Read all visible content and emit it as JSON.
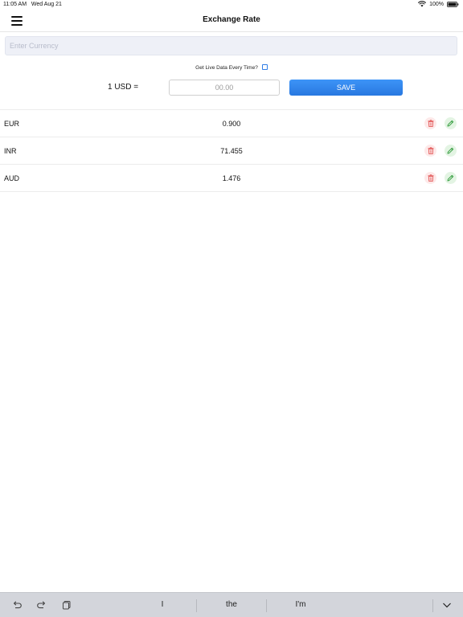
{
  "status_bar": {
    "time": "11:05 AM",
    "date": "Wed Aug 21",
    "battery": "100%",
    "icons": [
      "wifi-icon",
      "battery-icon"
    ]
  },
  "nav": {
    "title": "Exchange Rate",
    "menu_icon": "hamburger-menu-icon"
  },
  "search": {
    "placeholder": "Enter Currency",
    "value": ""
  },
  "live_data": {
    "label": "Get Live Data Every Time?",
    "checked": false
  },
  "rate_form": {
    "label": "1 USD =",
    "placeholder": "00.00",
    "save_label": "SAVE"
  },
  "rates": [
    {
      "code": "EUR",
      "value": "0.900"
    },
    {
      "code": "INR",
      "value": "71.455"
    },
    {
      "code": "AUD",
      "value": "1.476"
    }
  ],
  "keyboard": {
    "suggestions": [
      "I",
      "the",
      "I'm"
    ],
    "icons": [
      "undo-icon",
      "redo-icon",
      "paste-icon",
      "dismiss-keyboard-icon"
    ]
  },
  "colors": {
    "accent": "#2f7de6",
    "delete": "#e35b5b",
    "edit": "#2f9a3a"
  }
}
